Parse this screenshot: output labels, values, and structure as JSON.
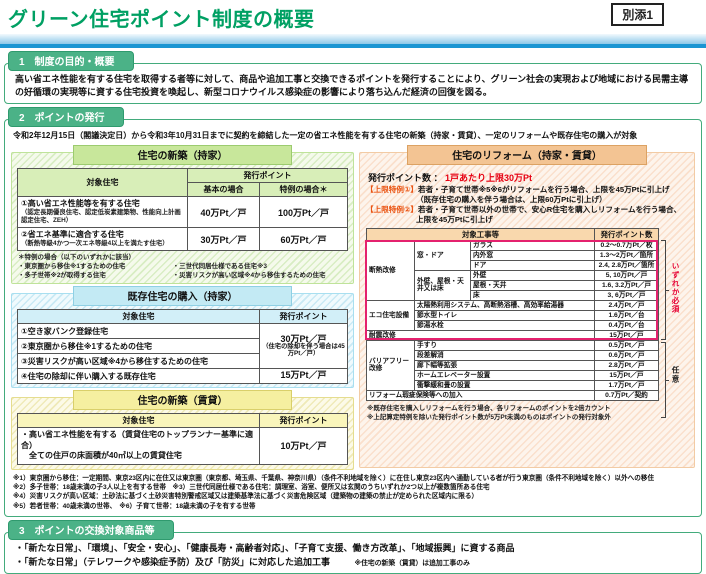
{
  "page": {
    "title": "グリーン住宅ポイント制度の概要",
    "badge": "別添1"
  },
  "colors": {
    "title_green": "#00a063",
    "section_green": "#4bb287",
    "box_border": "#43ab7c",
    "blue_bar": "#1a95d2",
    "accent_red": "#e60012",
    "special_label_orange": "#ea5514",
    "required_pink": "#e4216e",
    "new_owner_green": "#c8e79b",
    "existing_cyan": "#c3eaf4",
    "rental_yellow": "#f5efa0",
    "reform_peach": "#f3c493"
  },
  "section1": {
    "heading": "1　制度の目的・概要",
    "body": "高い省エネ性能を有する住宅を取得する者等に対して、商品や追加工事と交換できるポイントを発行することにより、グリーン社会の実現および地域における民需主導の好循環の実現等に資する住宅投資を喚起し、新型コロナウイルス感染症の影響により落ち込んだ経済の回復を図る。"
  },
  "section2": {
    "heading": "2　ポイントの発行",
    "intro": "令和2年12月15日（閣議決定日）から令和3年10月31日までに契約を締結した一定の省エネ性能を有する住宅の新築（持家・賃貸）、一定のリフォームや既存住宅の購入が対象",
    "new_owner": {
      "title": "住宅の新築（持家）",
      "col_target": "対象住宅",
      "col_points": "発行ポイント",
      "col_basic": "基本の場合",
      "col_special": "特例の場合＊",
      "rows": [
        {
          "main": "①高い省エネ性能等を有する住宅",
          "sub": "（認定長期優良住宅、認定低炭素建築物、性能向上計画認定住宅、ZEH）",
          "basic": "40万Pt／戸",
          "special": "100万Pt／戸"
        },
        {
          "main": "②省エネ基準に適合する住宅",
          "sub": "（断熱等級4かつ一次エネ等級4以上を満たす住宅）",
          "basic": "30万Pt／戸",
          "special": "60万Pt／戸"
        }
      ],
      "note_title": "＊特例の場合（以下のいずれかに該当）",
      "note_l1": "・東京圏から移住※1するための住宅",
      "note_r1": "・三世代同居仕様である住宅※3",
      "note_l2": "・多子世帯※2が取得する住宅",
      "note_r2": "・災害リスクが高い区域※4から移住するための住宅"
    },
    "existing": {
      "title": "既存住宅の購入（持家）",
      "col_target": "対象住宅",
      "col_points": "発行ポイント",
      "row1": "①空き家バンク登録住宅",
      "row2": "②東京圏から移住※1するための住宅",
      "row3": "③災害リスクが高い区域※4から移住するための住宅",
      "merged_main": "30万Pt／戸",
      "merged_sub": "（住宅の除却を伴う場合は45万Pt／戸）",
      "row4": "④住宅の除却に伴い購入する既存住宅",
      "row4_points": "15万Pt／戸"
    },
    "new_rental": {
      "title": "住宅の新築（賃貸）",
      "col_target": "対象住宅",
      "col_points": "発行ポイント",
      "row_line1": "・高い省エネ性能を有する（賃貸住宅のトップランナー基準に適合）",
      "row_line2": "　全ての住戸の床面積が40㎡以上の賃貸住宅",
      "points": "10万Pt／戸"
    },
    "reform": {
      "title": "住宅のリフォーム（持家・賃貸）",
      "points_label": "発行ポイント数 ：",
      "points_value": "1戸あたり上限30万Pt",
      "sp1_label": "【上限特例①】",
      "sp1_text": "若者・子育て世帯※5※6がリフォームを行う場合、上限を45万Ptに引上げ",
      "sp1_cont": "（既存住宅の購入を伴う場合は、上限60万Ptに引上げ）",
      "sp2_label": "【上限特例②】",
      "sp2_text": "若者・子育て世帯以外の世帯で、安心R住宅を購入しリフォームを行う場合、",
      "sp2_cont": "上限を45万Ptに引上げ",
      "col_work": "対象工事等",
      "col_points": "発行ポイント数",
      "rows": [
        {
          "group": "断熱改修",
          "sub": "窓・ドア",
          "item": "ガラス",
          "points": "0.2～0.7万Pt／枚"
        },
        {
          "item": "内外窓",
          "points": "1.3～2万Pt／箇所"
        },
        {
          "item": "ドア",
          "points": "2.4, 2.8万Pt／箇所"
        },
        {
          "sub": "外壁、屋根・天井又は床",
          "item": "外壁",
          "points": "5, 10万Pt／戸"
        },
        {
          "item": "屋根・天井",
          "points": "1.6, 3.2万Pt／戸"
        },
        {
          "item": "床",
          "points": "3, 6万Pt／戸"
        },
        {
          "group": "エコ住宅設備",
          "item": "太陽熱利用システム、高断熱浴槽、高効率給湯器",
          "points": "2.4万Pt／戸"
        },
        {
          "item": "節水型トイレ",
          "points": "1.6万Pt／台"
        },
        {
          "item": "節湯水栓",
          "points": "0.4万Pt／台"
        },
        {
          "item": "耐震改修",
          "points": "15万Pt／戸"
        },
        {
          "group": "バリアフリー改修",
          "item": "手すり",
          "points": "0.5万Pt／戸"
        },
        {
          "item": "段差解消",
          "points": "0.6万Pt／戸"
        },
        {
          "item": "廊下幅等拡張",
          "points": "2.8万Pt／戸"
        },
        {
          "item": "ホームエレベーター設置",
          "points": "15万Pt／戸"
        },
        {
          "item": "衝撃緩和畳の設置",
          "points": "1.7万Pt／戸"
        },
        {
          "item": "リフォーム瑕疵保険等への加入",
          "points": "0.7万Pt／契約"
        }
      ],
      "required_label": "いずれか必須",
      "optional_label": "任意",
      "note1": "※既存住宅を購入しリフォームを行う場合、各リフォームのポイントを2倍カウント",
      "note2": "※上記算定特例を除いた発行ポイント数が5万Pt未満のものはポイントの発行対象外"
    },
    "footnotes": [
      "※1）東京圏から移住：一定期間、東京23区内に在住又は東京圏（東京都、埼玉県、千葉県、神奈川県）（条件不利地域を除く）に在住し東京23区内へ通勤している者が行う東京圏（条件不利地域を除く）以外への移住",
      "※2）多子世帯：18歳未満の子3人以上を有する世帯　※3）三世代同居仕様である住宅：調理室、浴室、便所又は玄関のうちいずれか2つ以上が複数箇所ある住宅",
      "※4）災害リスクが高い区域：土砂法に基づく土砂災害特別警戒区域又は建築基準法に基づく災害危険区域（建築物の建築の禁止が定められた区域内に限る）",
      "※5）若者世帯：40歳未満の世帯、　※6）子育て世帯：18歳未満の子を有する世帯"
    ]
  },
  "section3": {
    "heading": "3　ポイントの交換対象商品等",
    "item1": "・「新たな日常」、「環境」、「安全・安心」、「健康長寿・高齢者対応」、「子育て支援、働き方改革」、「地域振興」に資する商品",
    "item2": "・「新たな日常」（テレワークや感染症予防）及び「防災」に対応した追加工事",
    "note": "※住宅の新築（賃貸）は追加工事のみ"
  }
}
